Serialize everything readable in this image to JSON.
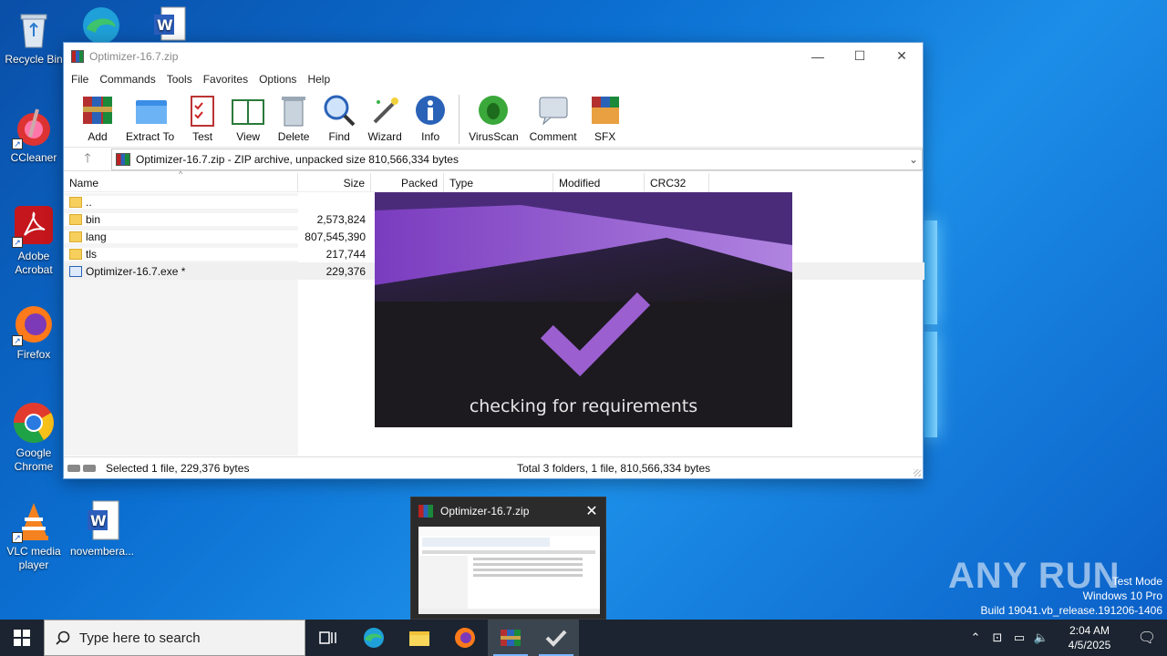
{
  "desktop": {
    "icons": [
      {
        "label": "Recycle Bin"
      },
      {
        "label": "CCleaner"
      },
      {
        "label": "Adobe Acrobat"
      },
      {
        "label": "Firefox"
      },
      {
        "label": "Google Chrome"
      },
      {
        "label": "VLC media player"
      },
      {
        "label": "novembera..."
      }
    ]
  },
  "window": {
    "title": "Optimizer-16.7.zip",
    "menu": [
      "File",
      "Commands",
      "Tools",
      "Favorites",
      "Options",
      "Help"
    ],
    "toolbar": [
      "Add",
      "Extract To",
      "Test",
      "View",
      "Delete",
      "Find",
      "Wizard",
      "Info",
      "VirusScan",
      "Comment",
      "SFX"
    ],
    "path": "Optimizer-16.7.zip - ZIP archive, unpacked size 810,566,334 bytes",
    "columns": [
      "Name",
      "Size",
      "Packed",
      "Type",
      "Modified",
      "CRC32"
    ],
    "rows": [
      {
        "name": "..",
        "size": "",
        "kind": "folder"
      },
      {
        "name": "bin",
        "size": "2,573,824",
        "kind": "folder"
      },
      {
        "name": "lang",
        "size": "807,545,390",
        "kind": "folder"
      },
      {
        "name": "tls",
        "size": "217,744",
        "kind": "folder"
      },
      {
        "name": "Optimizer-16.7.exe *",
        "size": "229,376",
        "kind": "exe"
      }
    ],
    "status_left": "Selected 1 file, 229,376 bytes",
    "status_right": "Total 3 folders, 1 file, 810,566,334 bytes"
  },
  "splash": {
    "message": "checking for requirements",
    "accent": "#9b5fd0"
  },
  "preview": {
    "title": "Optimizer-16.7.zip"
  },
  "watermark": {
    "brand": "ANY RUN",
    "line1": "Test Mode",
    "line2": "Windows 10 Pro",
    "line3": "Build 19041.vb_release.191206-1406"
  },
  "taskbar": {
    "search_placeholder": "Type here to search",
    "time": "2:04 AM",
    "date": "4/5/2025"
  }
}
